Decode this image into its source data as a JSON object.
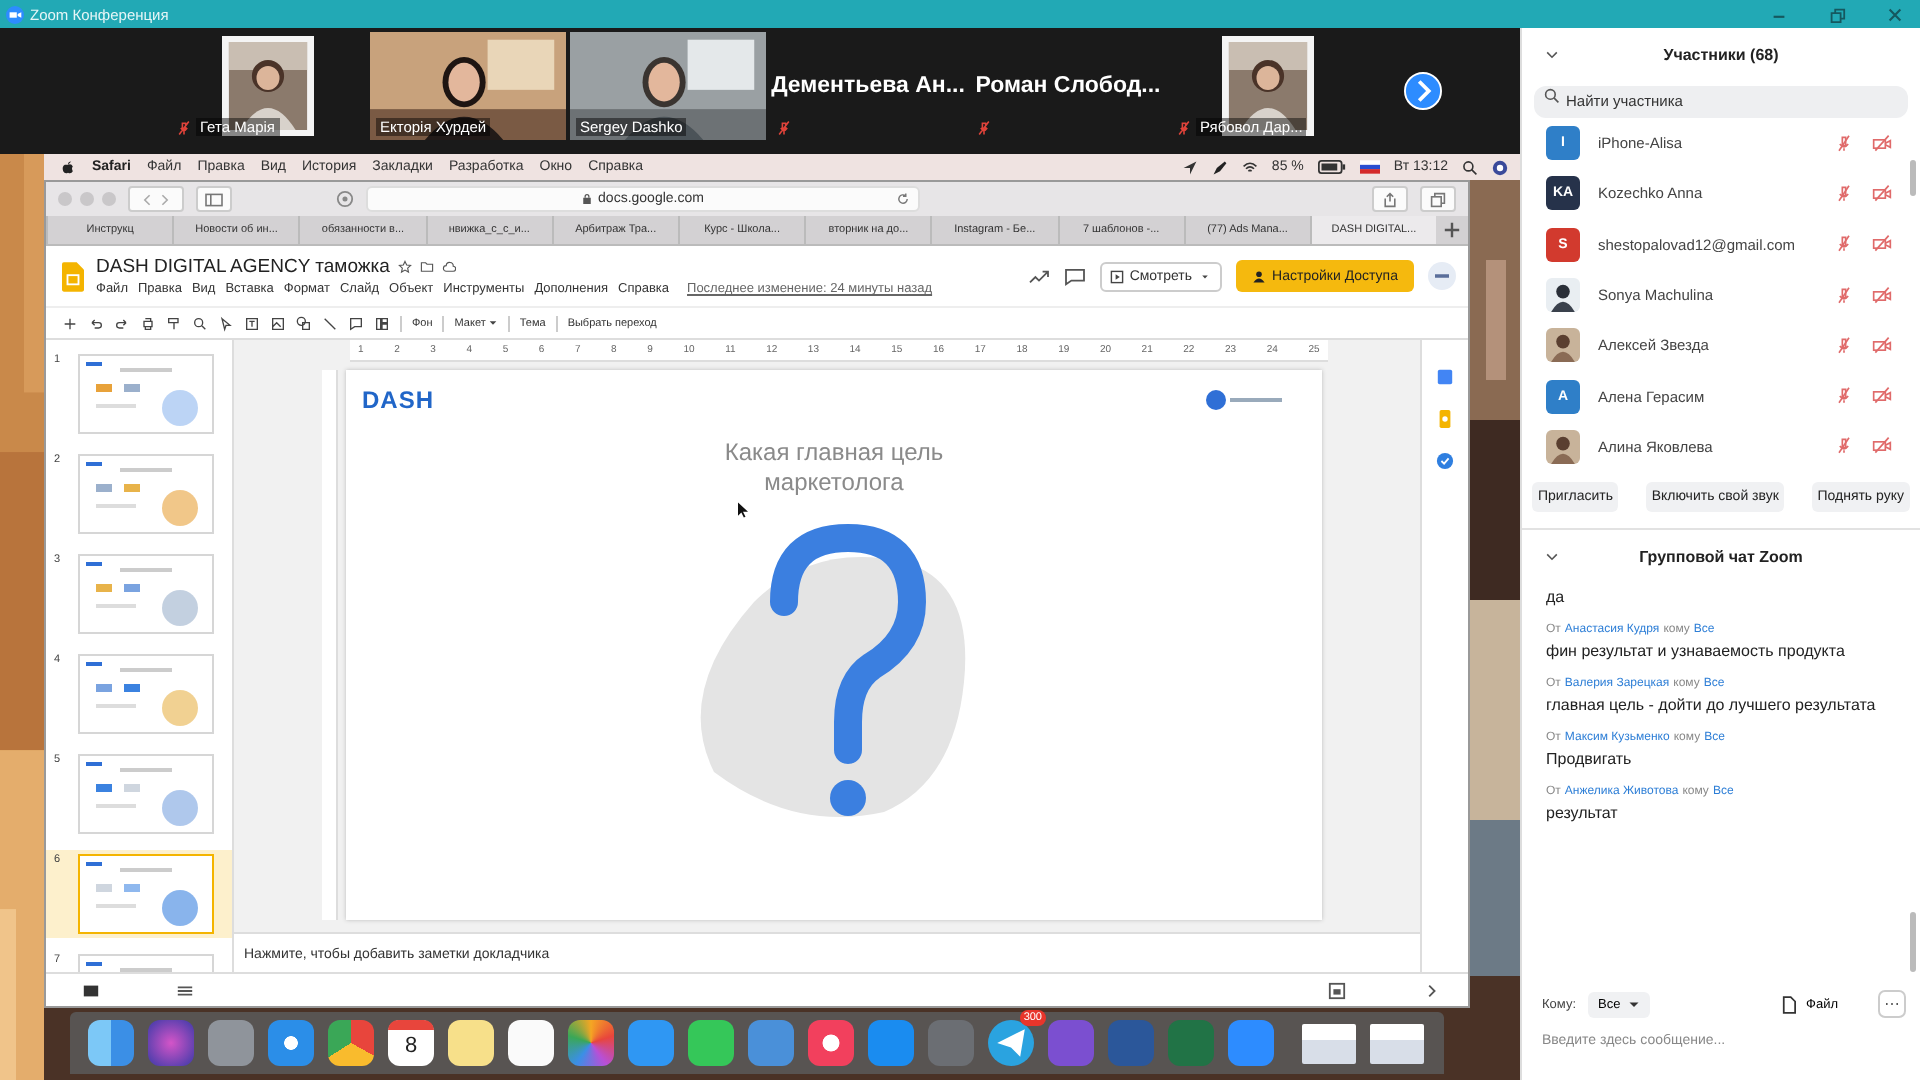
{
  "window": {
    "title": "Zoom Конференция"
  },
  "video_strip": {
    "tiles": [
      {
        "name": "Гета Марія",
        "kind": "avatar",
        "muted": true
      },
      {
        "name": "Екторія Хурдей",
        "kind": "video",
        "muted": false
      },
      {
        "name": "Sergey Dashko",
        "kind": "video",
        "muted": false
      },
      {
        "name": "Дементьева Ан...",
        "kind": "name",
        "muted": true
      },
      {
        "name": "Роман Слобод...",
        "kind": "name",
        "muted": true
      },
      {
        "name": "Рябовол Дар...",
        "kind": "avatar",
        "muted": true
      }
    ]
  },
  "mac_menu_bar": {
    "app": "Safari",
    "items": [
      "Файл",
      "Правка",
      "Вид",
      "История",
      "Закладки",
      "Разработка",
      "Окно",
      "Справка"
    ],
    "battery": "85 %",
    "clock": "Вт 13:12"
  },
  "browser": {
    "address": "docs.google.com",
    "tabs": [
      {
        "label": "Инструкц",
        "selected": false
      },
      {
        "label": "Новости об ин...",
        "selected": false
      },
      {
        "label": "обязанности в...",
        "selected": false
      },
      {
        "label": "нвижка_с_с_и...",
        "selected": false
      },
      {
        "label": "Арбитраж Тра...",
        "selected": false
      },
      {
        "label": "Курс - Школа...",
        "selected": false
      },
      {
        "label": "вторник на до...",
        "selected": false
      },
      {
        "label": "Instagram - Бе...",
        "selected": false
      },
      {
        "label": "7 шаблонов -...",
        "selected": false
      },
      {
        "label": "(77) Ads Mana...",
        "selected": false
      },
      {
        "label": "DASH DIGITAL...",
        "selected": true
      }
    ]
  },
  "docs": {
    "title": "DASH DIGITAL AGENCY таможка",
    "menu": [
      "Файл",
      "Правка",
      "Вид",
      "Вставка",
      "Формат",
      "Слайд",
      "Объект",
      "Инструменты",
      "Дополнения",
      "Справка"
    ],
    "last_edit": "Последнее изменение: 24 минуты назад",
    "view_button": "Смотреть",
    "share_button": "Настройки Доступа",
    "toolbar_labels": [
      {
        "label": "Фон",
        "dropdown": false
      },
      {
        "label": "Макет",
        "dropdown": true
      },
      {
        "label": "Тема",
        "dropdown": false
      },
      {
        "label": "Выбрать переход",
        "dropdown": false
      }
    ],
    "slides": [
      {
        "number": "1",
        "selected": false
      },
      {
        "number": "2",
        "selected": false
      },
      {
        "number": "3",
        "selected": false
      },
      {
        "number": "4",
        "selected": false
      },
      {
        "number": "5",
        "selected": false
      },
      {
        "number": "6",
        "selected": true
      },
      {
        "number": "7",
        "selected": false
      }
    ],
    "ruler": [
      "1",
      "2",
      "3",
      "4",
      "5",
      "6",
      "7",
      "8",
      "9",
      "10",
      "11",
      "12",
      "13",
      "14",
      "15",
      "16",
      "17",
      "18",
      "19",
      "20",
      "21",
      "22",
      "23",
      "24",
      "25"
    ],
    "slide": {
      "logo": "DASH",
      "title": "Какая главная цель маркетолога"
    },
    "notes_placeholder": "Нажмите, чтобы добавить заметки докладчика"
  },
  "dock": {
    "calendar_day": "8",
    "telegram_badge": "300"
  },
  "participants_panel": {
    "title": "Участники (68)",
    "search_placeholder": "Найти участника",
    "participants": [
      {
        "name": "iPhone-Alisa",
        "kind": "initials",
        "initials": "I",
        "color": "#2f7fc8",
        "muted": true,
        "video_off": true
      },
      {
        "name": "Kozechko Anna",
        "kind": "initials",
        "initials": "KA",
        "color": "#26324a",
        "muted": true,
        "video_off": true
      },
      {
        "name": "shestopalovad12@gmail.com",
        "kind": "initials",
        "initials": "S",
        "color": "#d23a2e",
        "muted": true,
        "video_off": true
      },
      {
        "name": "Sonya Machulina",
        "muted": true,
        "video_off": true
      },
      {
        "name": "Алексей Звезда",
        "muted": true,
        "video_off": true
      },
      {
        "name": "Алена Герасим",
        "kind": "initials",
        "initials": "A",
        "color": "#2f7fc8",
        "muted": true,
        "video_off": true
      },
      {
        "name": "Алина Яковлева",
        "muted": true,
        "video_off": true
      }
    ],
    "buttons": [
      "Пригласить",
      "Включить свой звук",
      "Поднять руку"
    ]
  },
  "chat": {
    "title": "Групповой чат Zoom",
    "messages": [
      {
        "kind": "continuation",
        "text": "да"
      },
      {
        "kind": "header",
        "from_word": "От",
        "sender": "Анастасия Кудря",
        "to_word": "кому",
        "recipient": "Все",
        "text": "фин результат и узнаваемость продукта"
      },
      {
        "kind": "header",
        "from_word": "От",
        "sender": "Валерия Зарецкая",
        "to_word": "кому",
        "recipient": "Все",
        "text": "главная цель - дойти до лучшего результата"
      },
      {
        "kind": "header",
        "from_word": "От",
        "sender": "Максим Кузьменко",
        "to_word": "кому",
        "recipient": "Все",
        "text": "Продвигать"
      },
      {
        "kind": "header",
        "from_word": "От",
        "sender": "Анжелика Животова",
        "to_word": "кому",
        "recipient": "Все",
        "text": "результат"
      }
    ],
    "to_label": "Кому:",
    "recipient": "Все",
    "file_button": "Файл",
    "input_placeholder": "Введите здесь сообщение..."
  }
}
